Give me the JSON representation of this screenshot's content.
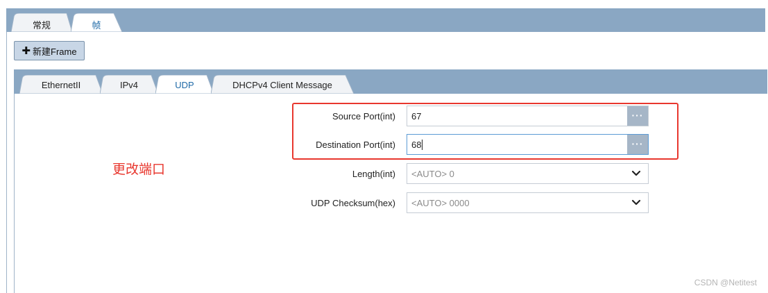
{
  "top_tabs": [
    {
      "label": "常规",
      "active": false
    },
    {
      "label": "帧",
      "active": true
    }
  ],
  "toolbar": {
    "new_frame_icon": "plus-icon",
    "new_frame_label": "新建Frame"
  },
  "protocol_tabs": [
    {
      "label": "EthernetII",
      "active": false
    },
    {
      "label": "IPv4",
      "active": false
    },
    {
      "label": "UDP",
      "active": true
    },
    {
      "label": "DHCPv4 Client Message",
      "active": false
    }
  ],
  "fields": {
    "source_port": {
      "label": "Source Port(int)",
      "value": "67",
      "button_icon": "ellipsis-icon"
    },
    "destination_port": {
      "label": "Destination Port(int)",
      "value": "68",
      "button_icon": "ellipsis-icon",
      "focused": true
    },
    "length": {
      "label": "Length(int)",
      "placeholder": "<AUTO> 0",
      "icon": "chevron-down-icon"
    },
    "udp_checksum": {
      "label": "UDP Checksum(hex)",
      "placeholder": "<AUTO> 0000",
      "icon": "chevron-down-icon"
    }
  },
  "annotation": {
    "text": "更改端口",
    "color": "#e8372e"
  },
  "watermark": "CSDN @Netitest",
  "colors": {
    "tabbar": "#8aa7c3",
    "active_tab_text": "#1f6aa7",
    "ellipsis_button": "#a6b6c7",
    "highlight": "#e8372e"
  }
}
